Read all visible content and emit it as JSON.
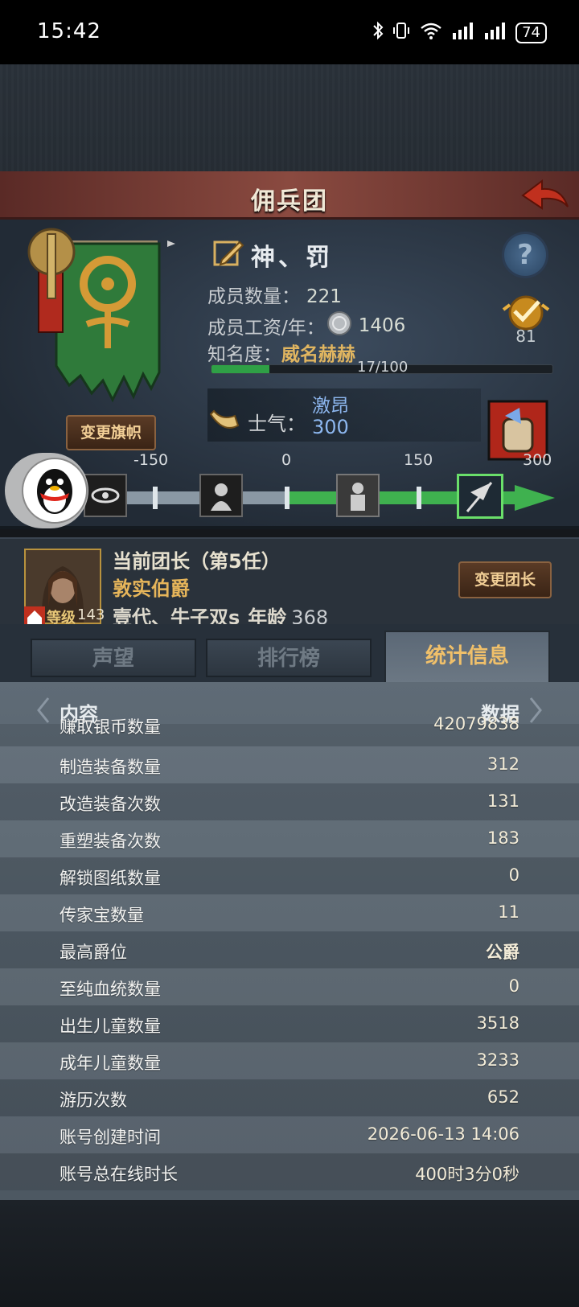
{
  "status_bar": {
    "time": "15:42",
    "battery": "74"
  },
  "header": {
    "title": "佣兵团"
  },
  "guild": {
    "name": "神、罚",
    "members_label": "成员数量：",
    "members": "221",
    "salary_label": "成员工资/年：",
    "salary": "1406",
    "fame_label": "知名度：",
    "fame_title": "威名赫赫",
    "fame_progress": "17/100",
    "fame_fraction": 0.17,
    "rank": "81",
    "change_flag_label": "变更旗帜"
  },
  "morale": {
    "label": "士气：",
    "state": "激昂",
    "value": "300",
    "ticks": [
      "-150",
      "0",
      "150",
      "300"
    ],
    "level_fraction": 1.0
  },
  "leader": {
    "title": "当前团长（第5任）",
    "rank_title": "敦实伯爵",
    "name": "壹代、牛子双s",
    "age_label": "年龄",
    "age": "368",
    "level_label": "等级",
    "level": "143",
    "change_leader_label": "变更团长"
  },
  "tabs": [
    {
      "label": "声望"
    },
    {
      "label": "排行榜"
    },
    {
      "label": "统计信息"
    }
  ],
  "stats": {
    "col_content": "内容",
    "col_data": "数据",
    "rows": [
      {
        "k": "赚取银币数量",
        "v": "42079838"
      },
      {
        "k": "制造装备数量",
        "v": "312"
      },
      {
        "k": "改造装备次数",
        "v": "131"
      },
      {
        "k": "重塑装备次数",
        "v": "183"
      },
      {
        "k": "解锁图纸数量",
        "v": "0"
      },
      {
        "k": "传家宝数量",
        "v": "11"
      },
      {
        "k": "最高爵位",
        "v": "公爵"
      },
      {
        "k": "至纯血统数量",
        "v": "0"
      },
      {
        "k": "出生儿童数量",
        "v": "3518"
      },
      {
        "k": "成年儿童数量",
        "v": "3233"
      },
      {
        "k": "游历次数",
        "v": "652"
      },
      {
        "k": "账号创建时间",
        "v": "2026-06-13 14:06"
      },
      {
        "k": "账号总在线时长",
        "v": "400时3分0秒"
      }
    ]
  },
  "colors": {
    "accent_gold": "#e0b560",
    "morale_green": "#3fb14f",
    "header_red": "#8a4a40",
    "morale_blue": "#8db7ef"
  }
}
